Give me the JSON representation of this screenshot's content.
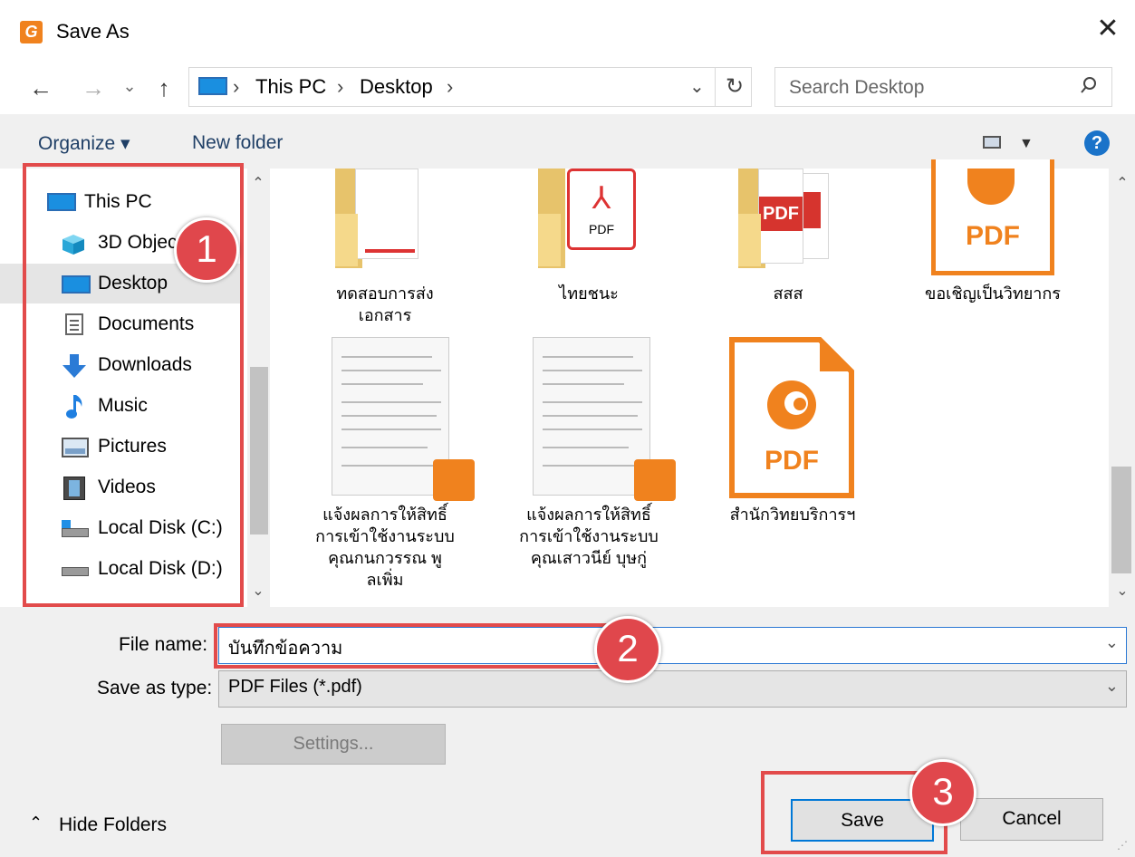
{
  "window": {
    "title": "Save As",
    "app_icon_letter": "G",
    "close_label": "✕"
  },
  "nav": {
    "back": "←",
    "forward": "→",
    "recent": "⌄",
    "up": "↑",
    "breadcrumb": [
      "This PC",
      "Desktop"
    ],
    "sep": "›",
    "search_placeholder": "Search Desktop",
    "refresh": "↻"
  },
  "toolbar": {
    "organize": "Organize ▾",
    "new_folder": "New folder",
    "help": "?"
  },
  "sidebar": {
    "items": [
      {
        "label": "This PC",
        "icon": "computer-icon"
      },
      {
        "label": "3D Objects",
        "icon": "cube-icon"
      },
      {
        "label": "Desktop",
        "icon": "desktop-icon",
        "selected": true
      },
      {
        "label": "Documents",
        "icon": "document-icon"
      },
      {
        "label": "Downloads",
        "icon": "download-arrow-icon"
      },
      {
        "label": "Music",
        "icon": "music-note-icon"
      },
      {
        "label": "Pictures",
        "icon": "picture-icon"
      },
      {
        "label": "Videos",
        "icon": "film-icon"
      },
      {
        "label": "Local Disk (C:)",
        "icon": "windows-drive-icon"
      },
      {
        "label": "Local Disk (D:)",
        "icon": "drive-icon"
      }
    ]
  },
  "files": [
    {
      "label": "ทดสอบการส่ง\nเอกสาร",
      "icon": "folder-with-document-icon"
    },
    {
      "label": "ไทยชนะ",
      "icon": "folder-with-pdf-icon"
    },
    {
      "label": "สสส",
      "icon": "folder-with-pdfs-icon"
    },
    {
      "label": "ขอเชิญเป็นวิทยากร",
      "icon": "foxit-pdf-icon"
    },
    {
      "label": "แจ้งผลการให้สิทธิ์\nการเข้าใช้งานระบบ\nคุณกนกวรรณ พู\nลเพิ่ม",
      "icon": "pdf-thumbnail-icon"
    },
    {
      "label": "แจ้งผลการให้สิทธิ์\nการเข้าใช้งานระบบ\nคุณเสาวนีย์ บุษกู่",
      "icon": "pdf-thumbnail-icon"
    },
    {
      "label": "สำนักวิทยบริการฯ",
      "icon": "foxit-pdf-icon"
    }
  ],
  "pdf_text": "PDF",
  "form": {
    "file_name_label": "File name:",
    "file_name_value": "บันทึกข้อความ",
    "save_type_label": "Save as type:",
    "save_type_value": "PDF Files (*.pdf)",
    "settings": "Settings...",
    "hide_folders": "Hide Folders",
    "save": "Save",
    "cancel": "Cancel"
  },
  "annotations": [
    "1",
    "2",
    "3"
  ],
  "colors": {
    "accent": "#0078d7",
    "foxit_orange": "#f0821e",
    "annotation_red": "#e24b4b"
  }
}
